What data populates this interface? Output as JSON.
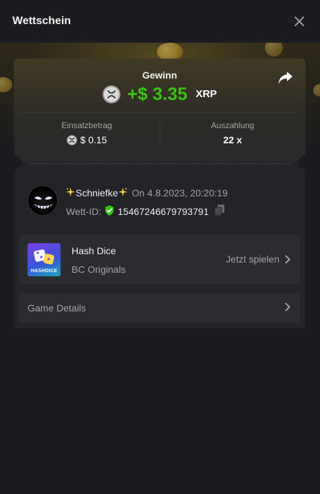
{
  "modal": {
    "title": "Wettschein"
  },
  "win": {
    "label": "Gewinn",
    "amount": "+$ 3.35",
    "currency": "XRP"
  },
  "stake": {
    "label": "Einsatzbetrag",
    "value": "$ 0.15"
  },
  "payout": {
    "label": "Auszahlung",
    "value": "22 x"
  },
  "bet": {
    "user_name": "Schniefke",
    "date": "On 4.8.2023, 20:20:19",
    "id_label": "Wett-ID:",
    "id_value": "15467246679793791"
  },
  "game": {
    "title": "Hash Dice",
    "provider": "BC Originals",
    "play_label": "Jetzt spielen",
    "thumb_text": "HASHDICE"
  },
  "details": {
    "label": "Game Details"
  },
  "colors": {
    "win_green": "#3bc117",
    "bg": "#1b1c1f",
    "card": "#2b2c30",
    "verified": "#3bc117"
  },
  "icons": {
    "close": "close-icon",
    "share": "share-icon",
    "currency": "xrp-icon",
    "sparkle": "sparkle-icon",
    "verified": "shield-check-icon",
    "copy": "copy-icon",
    "chevron": "chevron-right-icon"
  }
}
